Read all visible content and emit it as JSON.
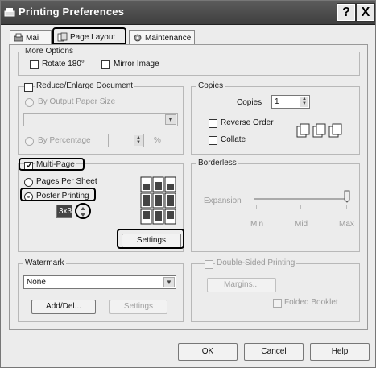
{
  "window": {
    "title": "Printing Preferences",
    "help_label": "?",
    "close_label": "X"
  },
  "tabs": [
    {
      "label": "Mai"
    },
    {
      "label": "Page Layout"
    },
    {
      "label": "Maintenance"
    }
  ],
  "more_options": {
    "legend": "More Options",
    "rotate_label": "Rotate 180°",
    "mirror_label": "Mirror Image"
  },
  "reduce": {
    "legend": "Reduce/Enlarge Document",
    "by_paper_label": "By Output Paper Size",
    "by_percentage_label": "By Percentage",
    "percent_sign": "%"
  },
  "copies": {
    "legend": "Copies",
    "copies_label": "Copies",
    "copies_value": "1",
    "reverse_label": "Reverse Order",
    "collate_label": "Collate"
  },
  "multipage": {
    "checkbox_label": "Multi-Page",
    "pages_per_sheet_label": "Pages Per Sheet",
    "poster_label": "Poster Printing",
    "poster_value": "3x3",
    "settings_label": "Settings"
  },
  "borderless": {
    "legend": "Borderless",
    "expansion_label": "Expansion",
    "min_label": "Min",
    "mid_label": "Mid",
    "max_label": "Max"
  },
  "watermark": {
    "legend": "Watermark",
    "selected": "None",
    "add_del_label": "Add/Del...",
    "settings_label": "Settings"
  },
  "double_sided": {
    "legend": "Double-Sided Printing",
    "margins_label": "Margins...",
    "folded_label": "Folded Booklet"
  },
  "footer": {
    "ok_label": "OK",
    "cancel_label": "Cancel",
    "help_label": "Help"
  }
}
